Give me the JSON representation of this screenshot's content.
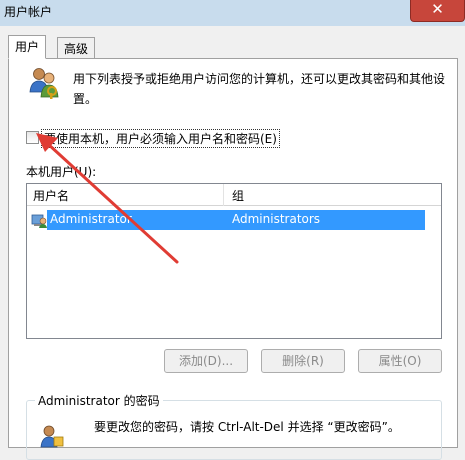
{
  "window": {
    "title": "用户帐户",
    "close_label": "✕"
  },
  "tabs": [
    {
      "label": "用户",
      "active": true
    },
    {
      "label": "高级",
      "active": false
    }
  ],
  "users_tab": {
    "description": "用下列表授予或拒绝用户访问您的计算机，还可以更改其密码和其他设置。",
    "require_password_checkbox": {
      "label": "要使用本机，用户必须输入用户名和密码(E)",
      "checked": false
    },
    "list_label": "本机用户(U):",
    "columns": [
      "用户名",
      "组"
    ],
    "rows": [
      {
        "username": "Administrator",
        "group": "Administrators",
        "selected": true
      }
    ],
    "buttons": {
      "add": "添加(D)...",
      "remove": "删除(R)",
      "properties": "属性(O)"
    },
    "password_group": {
      "title": "Administrator 的密码",
      "text": "要更改您的密码，请按 Ctrl-Alt-Del 并选择 “更改密码”。"
    }
  },
  "colors": {
    "titlebar": "#c8dced",
    "close_button": "#c7463b",
    "selection": "#3399ff",
    "annotation_arrow": "#e03c34"
  }
}
